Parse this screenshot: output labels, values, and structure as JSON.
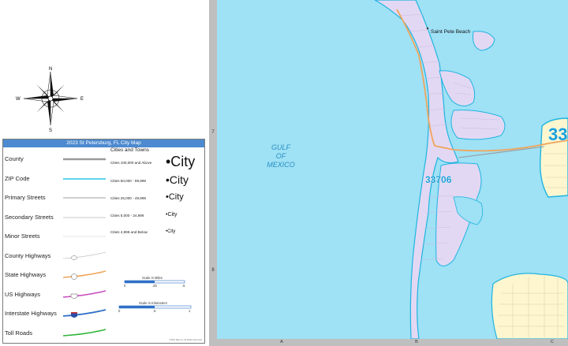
{
  "compass": {
    "n": "N",
    "s": "S",
    "e": "E",
    "w": "W"
  },
  "legend": {
    "title": "2023 St Petersburg, FL City Map",
    "items": [
      {
        "label": "County",
        "sample": "county"
      },
      {
        "label": "ZIP Code",
        "sample": "zip"
      },
      {
        "label": "Primary Streets",
        "sample": "primary"
      },
      {
        "label": "Secondary Streets",
        "sample": "secondary"
      },
      {
        "label": "Minor Streets",
        "sample": "minor"
      },
      {
        "label": "County Highways",
        "sample": "county-hwy"
      },
      {
        "label": "State Highways",
        "sample": "state-hwy"
      },
      {
        "label": "US Highways",
        "sample": "us-hwy"
      },
      {
        "label": "Interstate Highways",
        "sample": "interstate"
      },
      {
        "label": "Toll Roads",
        "sample": "toll"
      }
    ],
    "cities_heading": "Cities and Towns",
    "cities": [
      {
        "range": "Cities 100,000 and Above",
        "sample": "•City"
      },
      {
        "range": "Cities 50,000 - 99,999",
        "sample": "•City"
      },
      {
        "range": "Cities 25,000 - 49,999",
        "sample": "•City"
      },
      {
        "range": "Cities 5,000 - 24,999",
        "sample": "•City"
      },
      {
        "range": "Cities 4,999 and Below",
        "sample": "•City"
      }
    ],
    "scale_miles": {
      "title": "Scale in Miles",
      "ticks": [
        "0",
        ".25",
        ".5"
      ]
    },
    "scale_km": {
      "title": "Scale in Kilometers",
      "ticks": [
        "0",
        ".5",
        "1"
      ]
    },
    "credit": "©2023 Map Co. All Rights Reserved"
  },
  "map": {
    "water_label_lines": [
      "GULF",
      "OF",
      "MEXICO"
    ],
    "place_label": "Saint Pete Beach",
    "zip_labels": [
      "33706",
      "33"
    ],
    "row_labels": [
      "7",
      "8"
    ],
    "col_labels": [
      "A",
      "B",
      "C"
    ]
  },
  "colors": {
    "water": "#9fe1f5",
    "land_island": "#e3d8f3",
    "land_mainland": "#fdf6cf",
    "zip_boundary": "#1fb5e0",
    "state_highway": "#f0a55a",
    "legend_header": "#4d8ad0",
    "zip_label": "#1a9fd8"
  }
}
